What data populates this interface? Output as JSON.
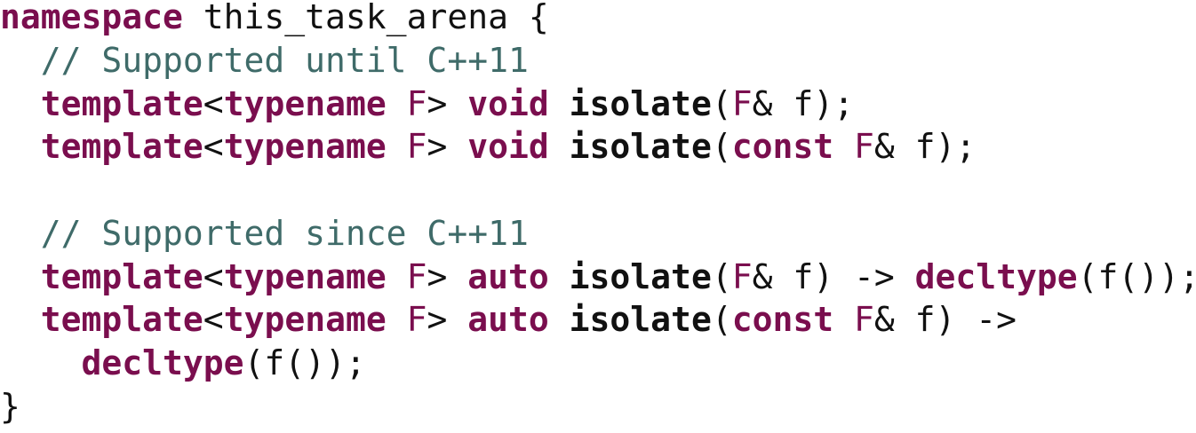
{
  "code_lines": [
    [
      {
        "text": "namespace",
        "cls": "tok-kw"
      },
      {
        "text": " this_task_arena {",
        "cls": "tok-plain"
      }
    ],
    [
      {
        "text": "  // Supported until C++11",
        "cls": "tok-comment"
      }
    ],
    [
      {
        "text": "  ",
        "cls": "tok-plain"
      },
      {
        "text": "template",
        "cls": "tok-kw"
      },
      {
        "text": "<",
        "cls": "tok-plain"
      },
      {
        "text": "typename",
        "cls": "tok-kw"
      },
      {
        "text": " ",
        "cls": "tok-plain"
      },
      {
        "text": "F",
        "cls": "tok-type"
      },
      {
        "text": "> ",
        "cls": "tok-plain"
      },
      {
        "text": "void",
        "cls": "tok-kw"
      },
      {
        "text": " ",
        "cls": "tok-plain"
      },
      {
        "text": "isolate",
        "cls": "tok-fn"
      },
      {
        "text": "(",
        "cls": "tok-plain"
      },
      {
        "text": "F",
        "cls": "tok-type"
      },
      {
        "text": "& f);",
        "cls": "tok-plain"
      }
    ],
    [
      {
        "text": "  ",
        "cls": "tok-plain"
      },
      {
        "text": "template",
        "cls": "tok-kw"
      },
      {
        "text": "<",
        "cls": "tok-plain"
      },
      {
        "text": "typename",
        "cls": "tok-kw"
      },
      {
        "text": " ",
        "cls": "tok-plain"
      },
      {
        "text": "F",
        "cls": "tok-type"
      },
      {
        "text": "> ",
        "cls": "tok-plain"
      },
      {
        "text": "void",
        "cls": "tok-kw"
      },
      {
        "text": " ",
        "cls": "tok-plain"
      },
      {
        "text": "isolate",
        "cls": "tok-fn"
      },
      {
        "text": "(",
        "cls": "tok-plain"
      },
      {
        "text": "const",
        "cls": "tok-kw"
      },
      {
        "text": " ",
        "cls": "tok-plain"
      },
      {
        "text": "F",
        "cls": "tok-type"
      },
      {
        "text": "& f);",
        "cls": "tok-plain"
      }
    ],
    [],
    [
      {
        "text": "  // Supported since C++11",
        "cls": "tok-comment"
      }
    ],
    [
      {
        "text": "  ",
        "cls": "tok-plain"
      },
      {
        "text": "template",
        "cls": "tok-kw"
      },
      {
        "text": "<",
        "cls": "tok-plain"
      },
      {
        "text": "typename",
        "cls": "tok-kw"
      },
      {
        "text": " ",
        "cls": "tok-plain"
      },
      {
        "text": "F",
        "cls": "tok-type"
      },
      {
        "text": "> ",
        "cls": "tok-plain"
      },
      {
        "text": "auto",
        "cls": "tok-kw"
      },
      {
        "text": " ",
        "cls": "tok-plain"
      },
      {
        "text": "isolate",
        "cls": "tok-fn"
      },
      {
        "text": "(",
        "cls": "tok-plain"
      },
      {
        "text": "F",
        "cls": "tok-type"
      },
      {
        "text": "& f) -> ",
        "cls": "tok-plain"
      },
      {
        "text": "decltype",
        "cls": "tok-kw"
      },
      {
        "text": "(f());",
        "cls": "tok-plain"
      }
    ],
    [
      {
        "text": "  ",
        "cls": "tok-plain"
      },
      {
        "text": "template",
        "cls": "tok-kw"
      },
      {
        "text": "<",
        "cls": "tok-plain"
      },
      {
        "text": "typename",
        "cls": "tok-kw"
      },
      {
        "text": " ",
        "cls": "tok-plain"
      },
      {
        "text": "F",
        "cls": "tok-type"
      },
      {
        "text": "> ",
        "cls": "tok-plain"
      },
      {
        "text": "auto",
        "cls": "tok-kw"
      },
      {
        "text": " ",
        "cls": "tok-plain"
      },
      {
        "text": "isolate",
        "cls": "tok-fn"
      },
      {
        "text": "(",
        "cls": "tok-plain"
      },
      {
        "text": "const",
        "cls": "tok-kw"
      },
      {
        "text": " ",
        "cls": "tok-plain"
      },
      {
        "text": "F",
        "cls": "tok-type"
      },
      {
        "text": "& f) ->",
        "cls": "tok-plain"
      }
    ],
    [
      {
        "text": "    ",
        "cls": "tok-plain"
      },
      {
        "text": "decltype",
        "cls": "tok-kw"
      },
      {
        "text": "(f());",
        "cls": "tok-plain"
      }
    ],
    [
      {
        "text": "}",
        "cls": "tok-plain"
      }
    ]
  ],
  "colors": {
    "keyword": "#7a0e4e",
    "comment": "#3f6b69",
    "text": "#111111",
    "background": "#ffffff"
  }
}
